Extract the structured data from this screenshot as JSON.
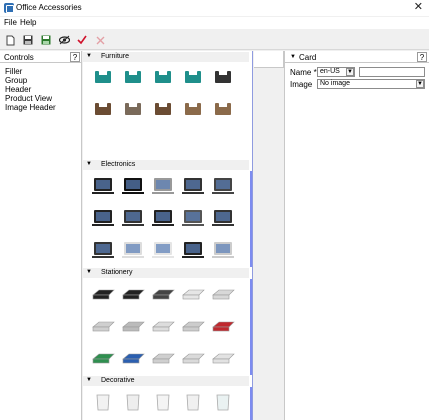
{
  "window": {
    "title": "Office Accessories",
    "close_glyph": "✕"
  },
  "menu": {
    "file": "File",
    "help": "Help"
  },
  "toolbar": {
    "buttons": [
      "new-icon",
      "save-icon",
      "save-as-icon",
      "preview-icon",
      "check-icon",
      "delete-icon"
    ],
    "accent": "#d0112b"
  },
  "controls": {
    "title": "Controls",
    "help": "?",
    "items": [
      "Filler",
      "Group",
      "Header",
      "Product View",
      "Image Header"
    ]
  },
  "gallery": {
    "sections": [
      {
        "name": "Furniture",
        "items": [
          "armchair-icon",
          "sofa-icon",
          "sofa-long-icon",
          "office-chair-icon",
          "lounge-chair-icon",
          "bar-stool-icon",
          "reception-desk-icon",
          "shelf-ladder-icon",
          "shelf-icon",
          "bookcase-icon"
        ]
      },
      {
        "name": "Electronics",
        "items": [
          "laptop-icon",
          "laptop-dark-icon",
          "laptop-silver-icon",
          "monitor-icon",
          "tablet-icon",
          "laptop-open-icon",
          "monitor-dark-icon",
          "phone-icon",
          "desktop-tower-icon",
          "tablet-landscape-icon",
          "small-phone-icon",
          "keyboard-icon",
          "mouse-icon",
          "headphones-icon",
          "pad-icon"
        ]
      },
      {
        "name": "Stationery",
        "items": [
          "pen-icon",
          "marker-icon",
          "stylus-icon",
          "tissue-box-icon",
          "tray-icon",
          "tape-dispenser-icon",
          "pen-holder-icon",
          "clips-tray-icon",
          "stapler-box-icon",
          "phone-red-icon",
          "tape-green-icon",
          "stapler-blue-icon",
          "stapler-remover-icon",
          "paper-tray-icon",
          "letter-tray-icon"
        ]
      },
      {
        "name": "Decorative",
        "items": [
          "mug-icon",
          "cup-icon",
          "teacup-icon",
          "saucer-icon",
          "glass-icon"
        ]
      }
    ]
  },
  "properties": {
    "title": "Card",
    "help": "?",
    "name_label": "Name",
    "required_mark": "*",
    "locale": "en-US",
    "name_value": "",
    "image_label": "Image",
    "image_value": "No image"
  }
}
